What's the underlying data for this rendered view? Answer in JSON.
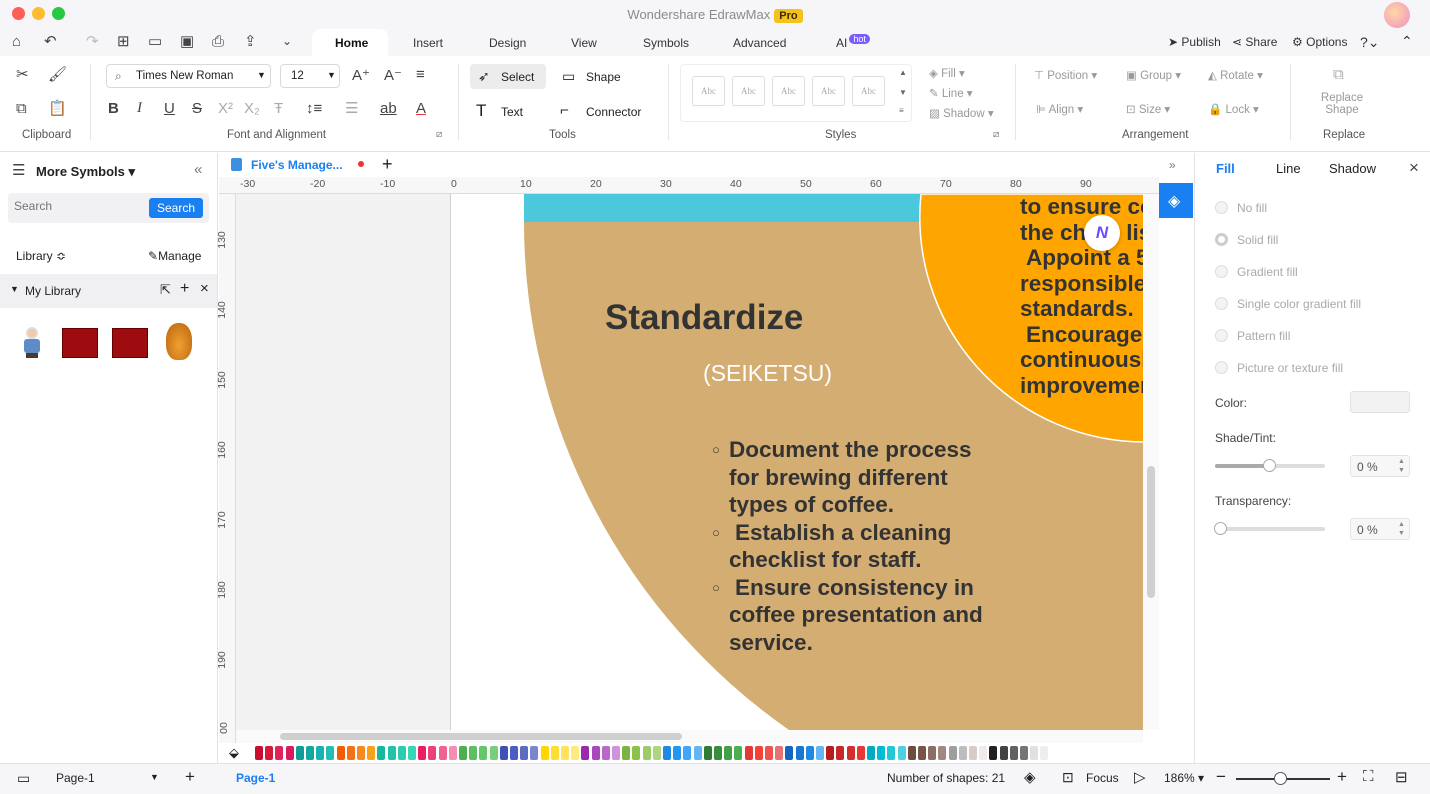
{
  "app": {
    "title": "Wondershare EdrawMax",
    "badge": "Pro"
  },
  "menu": {
    "tabs": [
      "Home",
      "Insert",
      "Design",
      "View",
      "Symbols",
      "Advanced",
      "AI"
    ],
    "ai_badge": "hot",
    "publish": "Publish",
    "share": "Share",
    "options": "Options"
  },
  "ribbon": {
    "font_family": "Times New Roman",
    "font_size": "12",
    "select": "Select",
    "shape": "Shape",
    "text": "Text",
    "connector": "Connector",
    "style_sample": "Abc",
    "fill": "Fill",
    "line": "Line",
    "shadow": "Shadow",
    "position": "Position",
    "group": "Group",
    "rotate": "Rotate",
    "align": "Align",
    "size": "Size",
    "lock": "Lock",
    "replace_shape": "Replace Shape",
    "groups": {
      "clipboard": "Clipboard",
      "font": "Font and Alignment",
      "tools": "Tools",
      "styles": "Styles",
      "arrangement": "Arrangement",
      "replace": "Replace"
    }
  },
  "left": {
    "title": "More Symbols",
    "search_placeholder": "Search",
    "search_button": "Search",
    "library": "Library",
    "manage": "Manage",
    "my_library": "My Library"
  },
  "doc": {
    "tab": "Five's Manage..."
  },
  "ruler": {
    "h": [
      "-30",
      "-20",
      "-10",
      "0",
      "10",
      "20",
      "30",
      "40",
      "50",
      "60",
      "70",
      "80",
      "90"
    ],
    "v": [
      "130",
      "140",
      "150",
      "160",
      "170",
      "180",
      "190",
      "00"
    ]
  },
  "diagram": {
    "heading": "Standardize",
    "subheading": "(SEIKETSU)",
    "bullets": [
      [
        "Document the process",
        "for brewing different",
        "types of coffee."
      ],
      [
        "Establish a cleaning",
        "checklist for staff."
      ],
      [
        "Ensure consistency in",
        "coffee presentation and",
        "service."
      ]
    ],
    "orange_lines": [
      "to ensure co",
      "the ch",
      "lis"
    ],
    "orange_bullets": [
      [
        "Appoint a 5",
        "responsible",
        "standards."
      ],
      [
        "Encourage",
        "continuousl",
        "improvemen"
      ]
    ],
    "colors": {
      "tan": "#d4ad72",
      "orange": "#ffa500",
      "cyan": "#4cc8dc"
    }
  },
  "right": {
    "tabs": [
      "Fill",
      "Line",
      "Shadow"
    ],
    "options": [
      "No fill",
      "Solid fill",
      "Gradient fill",
      "Single color gradient fill",
      "Pattern fill",
      "Picture or texture fill"
    ],
    "color_label": "Color:",
    "shade_label": "Shade/Tint:",
    "shade_value": "0 %",
    "transparency_label": "Transparency:",
    "transparency_value": "0 %"
  },
  "status": {
    "page_select": "Page-1",
    "page_tab": "Page-1",
    "shapes": "Number of shapes: 21",
    "focus": "Focus",
    "zoom": "186%"
  }
}
